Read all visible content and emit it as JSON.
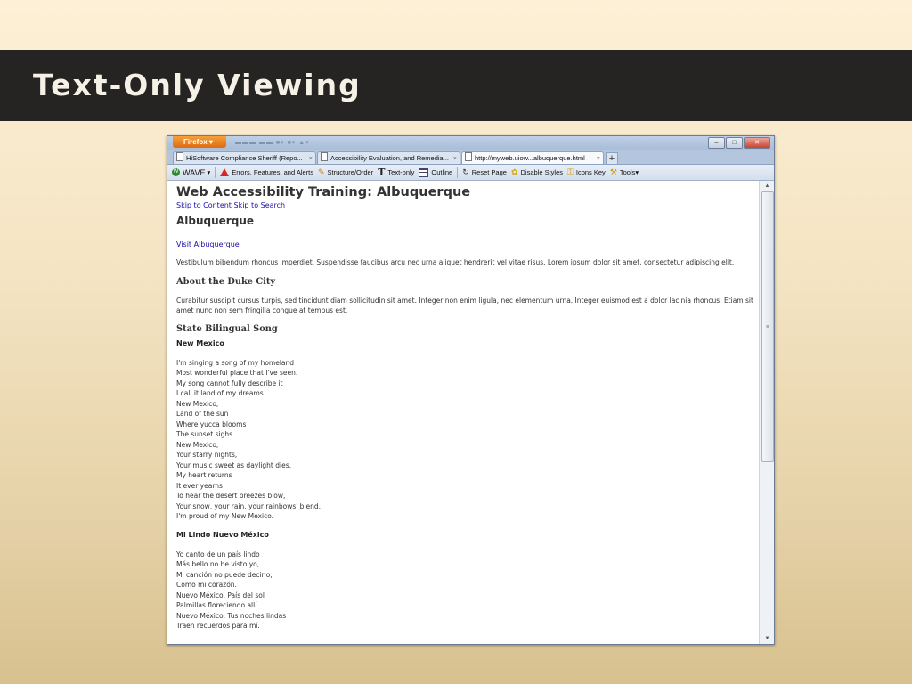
{
  "slide": {
    "title": "Text-Only Viewing"
  },
  "browser": {
    "app_button": "Firefox",
    "tabs": [
      {
        "label": "HiSoftware Compliance Sheriff (Repo...",
        "close": "×"
      },
      {
        "label": "Accessibility Evaluation, and Remedia...",
        "close": "×"
      },
      {
        "label": "http://myweb.uiow...albuquerque.html",
        "close": "×"
      }
    ],
    "new_tab": "+",
    "toolbar": {
      "wave": "WAVE",
      "errors": "Errors, Features, and Alerts",
      "structure": "Structure/Order",
      "text_only": "Text-only",
      "outline": "Outline",
      "reset": "Reset Page",
      "disable_styles": "Disable Styles",
      "icons_key": "Icons Key",
      "tools": "Tools"
    }
  },
  "page": {
    "heading": "Web Accessibility Training: Albuquerque",
    "skip_content": "Skip to Content",
    "skip_search": "Skip to Search",
    "subheading": "Albuquerque",
    "visit_link": "Visit Albuquerque",
    "intro": "Vestibulum bibendum rhoncus imperdiet. Suspendisse faucibus arcu nec urna aliquet hendrerit vel vitae risus. Lorem ipsum dolor sit amet, consectetur adipiscing elit.",
    "about_heading": "About the Duke City",
    "about_text": "Curabitur suscipit cursus turpis, sed tincidunt diam sollicitudin sit amet. Integer non enim ligula, nec elementum urna. Integer euismod est a dolor lacinia rhoncus. Etiam sit amet nunc non sem fringilla congue at tempus est.",
    "song_heading": "State Bilingual Song",
    "english_title": "New Mexico",
    "english_lines": [
      "I'm singing a song of my homeland",
      "Most wonderful place that I've seen.",
      "My song cannot fully describe it",
      "I call it land of my dreams.",
      "New Mexico,",
      "Land of the sun",
      "Where yucca blooms",
      "The sunset sighs.",
      "New Mexico,",
      "Your starry nights,",
      "Your music sweet as daylight dies.",
      "My heart returns",
      "It ever yearns",
      "To hear the desert breezes blow,",
      "Your snow, your rain, your rainbows' blend,",
      "I'm proud of my New Mexico."
    ],
    "spanish_title": "Mi Lindo Nuevo México",
    "spanish_lines": [
      "Yo canto de un país lindo",
      "Más bello no he visto yo,",
      "Mi canción no puede decirlo,",
      "Como mi corazón.",
      "Nuevo México, País del sol",
      "Palmillas floreciendo allí.",
      "Nuevo México, Tus noches lindas",
      "Traen recuerdos para mí."
    ]
  }
}
